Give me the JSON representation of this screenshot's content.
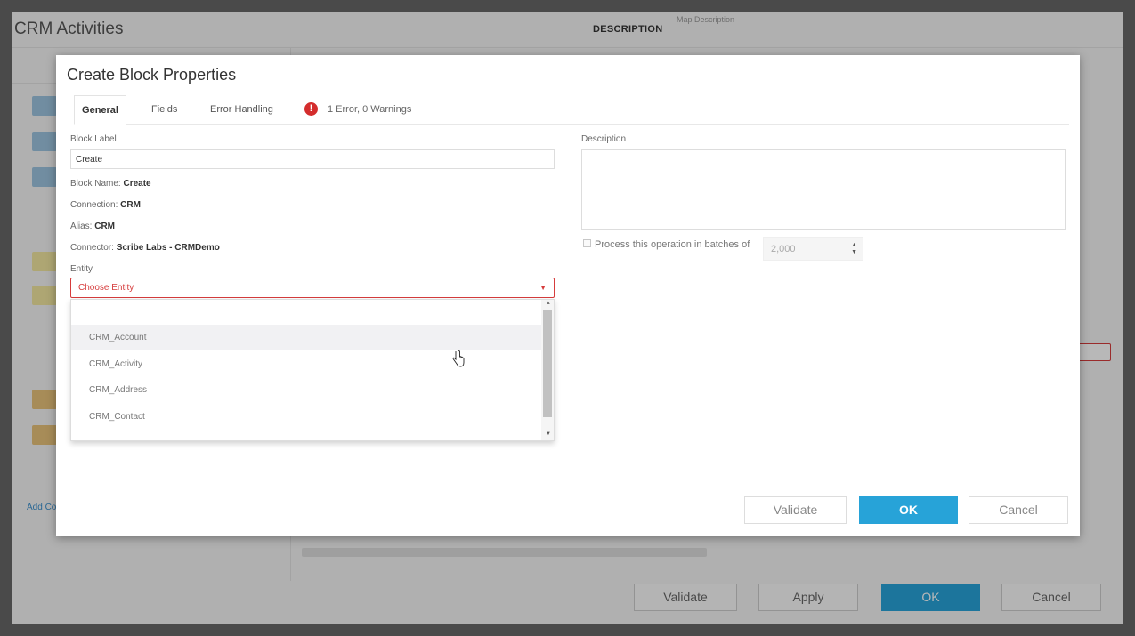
{
  "app": {
    "title": "CRM Activities",
    "description_label": "DESCRIPTION",
    "description_placeholder": "Map Description",
    "add_link": "Add Co",
    "buttons": {
      "validate": "Validate",
      "apply": "Apply",
      "ok": "OK",
      "cancel": "Cancel"
    }
  },
  "modal": {
    "title": "Create Block Properties",
    "tabs": [
      {
        "label": "General",
        "active": true
      },
      {
        "label": "Fields",
        "active": false
      },
      {
        "label": "Error Handling",
        "active": false
      }
    ],
    "error_icon": "!",
    "error_summary": "1 Error, 0 Warnings",
    "block_label": {
      "label": "Block Label",
      "value": "Create"
    },
    "block_name": {
      "label": "Block Name:",
      "value": "Create"
    },
    "connection": {
      "label": "Connection:",
      "value": "CRM"
    },
    "alias": {
      "label": "Alias:",
      "value": "CRM"
    },
    "connector": {
      "label": "Connector:",
      "value": "Scribe Labs - CRMDemo"
    },
    "entity": {
      "label": "Entity",
      "placeholder": "Choose Entity",
      "options": [
        "CRM_Account",
        "CRM_Activity",
        "CRM_Address",
        "CRM_Contact"
      ],
      "hover_index": 0
    },
    "description": {
      "label": "Description",
      "value": ""
    },
    "batch": {
      "label": "Process this operation in batches of",
      "value": "2,000",
      "checked": false
    },
    "buttons": {
      "validate": "Validate",
      "ok": "OK",
      "cancel": "Cancel"
    }
  },
  "colors": {
    "accent": "#27a3d8",
    "error": "#d63c3c"
  }
}
